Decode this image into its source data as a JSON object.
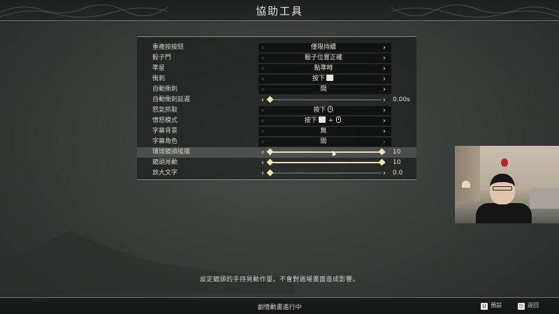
{
  "header": {
    "title": "協助工具"
  },
  "settings": {
    "rows": [
      {
        "label": "重複按按鈕",
        "value": "僅限持續",
        "type": "option",
        "left_active": false,
        "right_active": true
      },
      {
        "label": "骰子門",
        "value": "骰子位置正確",
        "type": "option",
        "left_active": false,
        "right_active": true
      },
      {
        "label": "準星",
        "value": "點準時",
        "type": "option",
        "left_active": false,
        "right_active": true
      },
      {
        "label": "衝刺",
        "value_prefix": "按下",
        "type": "keybind",
        "keys": [
          "key"
        ],
        "left_active": false,
        "right_active": true
      },
      {
        "label": "自動衝刺",
        "value": "開",
        "type": "option",
        "left_active": false,
        "right_active": true
      },
      {
        "label": "自動衝刺延遲",
        "type": "slider",
        "level": 0.0,
        "readout": "0.00s",
        "left_active": true,
        "right_active": true
      },
      {
        "label": "怒氣抓取",
        "value_prefix": "按下",
        "type": "keybind",
        "keys": [
          "mouse"
        ],
        "left_active": false,
        "right_active": true
      },
      {
        "label": "憤怒模式",
        "value_prefix": "按下",
        "type": "keybind",
        "keys": [
          "key",
          "mouse"
        ],
        "joiner": "+",
        "left_active": false,
        "right_active": true
      },
      {
        "label": "字幕背景",
        "value": "無",
        "type": "option",
        "left_active": false,
        "right_active": true
      },
      {
        "label": "字幕角色",
        "value": "開",
        "type": "option",
        "left_active": false,
        "right_active": false
      },
      {
        "label": "環境鏡頭搖擺",
        "type": "slider",
        "level": 1.0,
        "readout": "10",
        "left_active": true,
        "right_active": true,
        "selected": true
      },
      {
        "label": "鏡頭晃動",
        "type": "slider",
        "level": 1.0,
        "readout": "10",
        "left_active": true,
        "right_active": true
      },
      {
        "label": "放大文字",
        "type": "slider",
        "level": 0.0,
        "readout": "0.0",
        "left_active": true,
        "right_active": true
      }
    ]
  },
  "description": "設定鏡頭的手持晃動作量。不會對過場畫面造成影響。",
  "footer": {
    "status": "劇情動畫進行中",
    "reset_label": "預設",
    "back_label": "返回"
  },
  "colors": {
    "slider_fill": "#e7dfb8",
    "selected_row": "#8a8a85"
  },
  "icons": {
    "key": "keyboard-key-icon",
    "mouse": "mouse-icon"
  }
}
